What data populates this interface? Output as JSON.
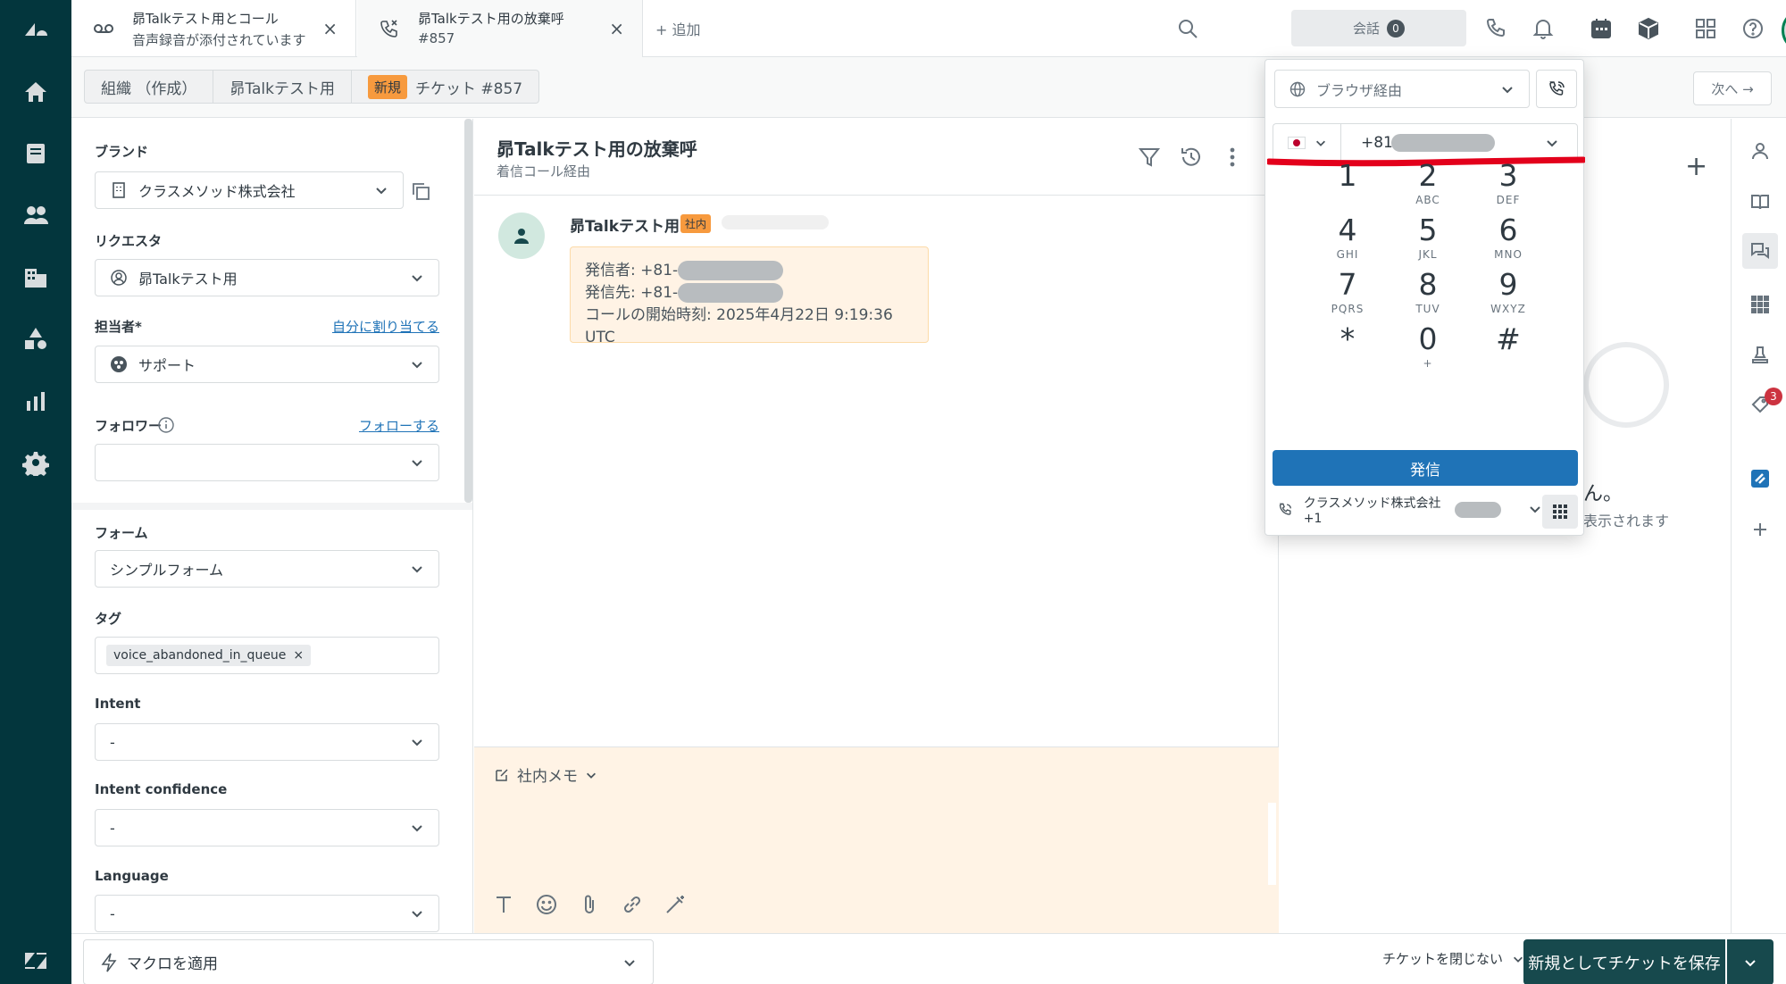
{
  "tabs": [
    {
      "title": "昴Talkテスト用とコール",
      "subtitle": "音声録音が添付されています"
    },
    {
      "title": "昴Talkテスト用の放棄呼",
      "subtitle": "#857"
    }
  ],
  "add_tab_label": "+ 追加",
  "header": {
    "conversations_label": "会話",
    "conversations_count": "0"
  },
  "breadcrumb": {
    "org": "組織 （作成）",
    "requester": "昴Talkテスト用",
    "status_badge": "新規",
    "ticket": "チケット #857"
  },
  "next_label": "次へ →",
  "properties": {
    "brand_label": "ブランド",
    "brand_value": "クラスメソッド株式会社",
    "requester_label": "リクエスタ",
    "requester_value": "昴Talkテスト用",
    "assignee_label": "担当者*",
    "assignee_link": "自分に割り当てる",
    "assignee_value": "サポート",
    "followers_label": "フォロワー",
    "followers_link": "フォローする",
    "form_label": "フォーム",
    "form_value": "シンプルフォーム",
    "tags_label": "タグ",
    "tag_value": "voice_abandoned_in_queue",
    "intent_label": "Intent",
    "intent_value": "-",
    "intent_conf_label": "Intent confidence",
    "intent_conf_value": "-",
    "language_label": "Language",
    "language_value": "-"
  },
  "conversation": {
    "title": "昴Talkテスト用の放棄呼",
    "subtitle": "着信コール経由",
    "author": "昴Talkテスト用",
    "internal_badge": "社内",
    "line1_prefix": "発信者: +81-",
    "line2_prefix": "発信先: +81-",
    "line3": "コールの開始時刻: 2025年4月22日 9:19:36 UTC",
    "composer_mode": "社内メモ"
  },
  "context": {
    "empty_text": "ん。",
    "empty_sub": "表示されます"
  },
  "app_badge_count": "3",
  "dialer": {
    "via_label": "ブラウザ経由",
    "phone_prefix": "+81",
    "keys": [
      {
        "d": "1",
        "l": ""
      },
      {
        "d": "2",
        "l": "ABC"
      },
      {
        "d": "3",
        "l": "DEF"
      },
      {
        "d": "4",
        "l": "GHI"
      },
      {
        "d": "5",
        "l": "JKL"
      },
      {
        "d": "6",
        "l": "MNO"
      },
      {
        "d": "7",
        "l": "PQRS"
      },
      {
        "d": "8",
        "l": "TUV"
      },
      {
        "d": "9",
        "l": "WXYZ"
      },
      {
        "d": "*",
        "l": ""
      },
      {
        "d": "0",
        "l": "+"
      },
      {
        "d": "#",
        "l": ""
      }
    ],
    "dial_label": "発信",
    "caller_id": "クラスメソッド株式会社 +1"
  },
  "footer": {
    "macro_label": "マクロを適用",
    "close_label": "チケットを閉じない",
    "save_label": "新規としてチケットを保存"
  },
  "colors": {
    "rail": "#03363d",
    "accent_blue": "#1f73b7",
    "save_button": "#17494d",
    "internal_note_bg": "#fff3e5",
    "status_new": "#f79a3e",
    "red_underline": "#e3001b"
  }
}
